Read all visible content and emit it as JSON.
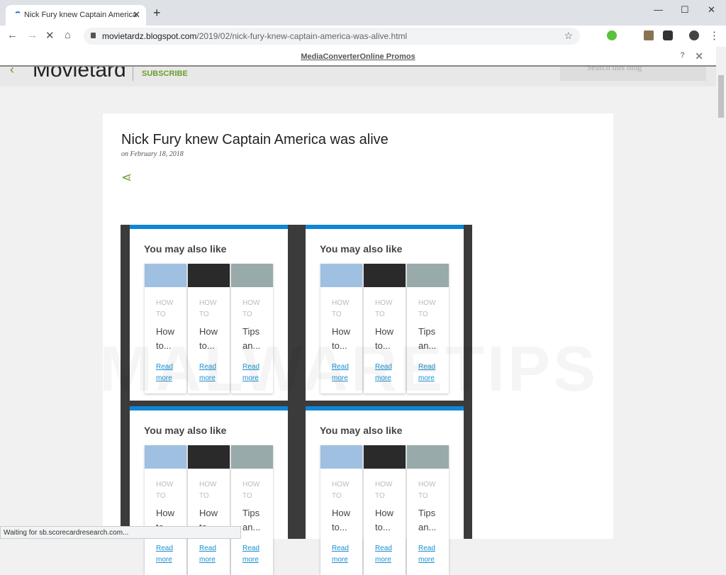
{
  "browser": {
    "tab_title": "Nick Fury knew Captain America",
    "url_host": "movietardz.blogspot.com",
    "url_path": "/2019/02/nick-fury-knew-captain-america-was-alive.html",
    "status": "Waiting for sb.scorecardresearch.com..."
  },
  "promo": {
    "label": "MediaConverterOnline Promos",
    "help": "?",
    "close": "✕"
  },
  "blog": {
    "logo": "Movietard",
    "subscribe": "SUBSCRIBE",
    "search_placeholder": "Search this blog"
  },
  "post": {
    "title": "Nick Fury knew Captain America was alive",
    "date": "on February 18, 2018"
  },
  "ad": {
    "heading": "You may also like",
    "items": [
      {
        "category": "HOW TO",
        "title": "How to...",
        "link": "Read more",
        "img": "#9fc0e0"
      },
      {
        "category": "HOW TO",
        "title": "How to...",
        "link": "Read more",
        "img": "#2a2a2a"
      },
      {
        "category": "HOW TO",
        "title": "Tips an...",
        "link": "Read more",
        "img": "#9aa"
      }
    ]
  },
  "watermark": "MALWARETIPS"
}
